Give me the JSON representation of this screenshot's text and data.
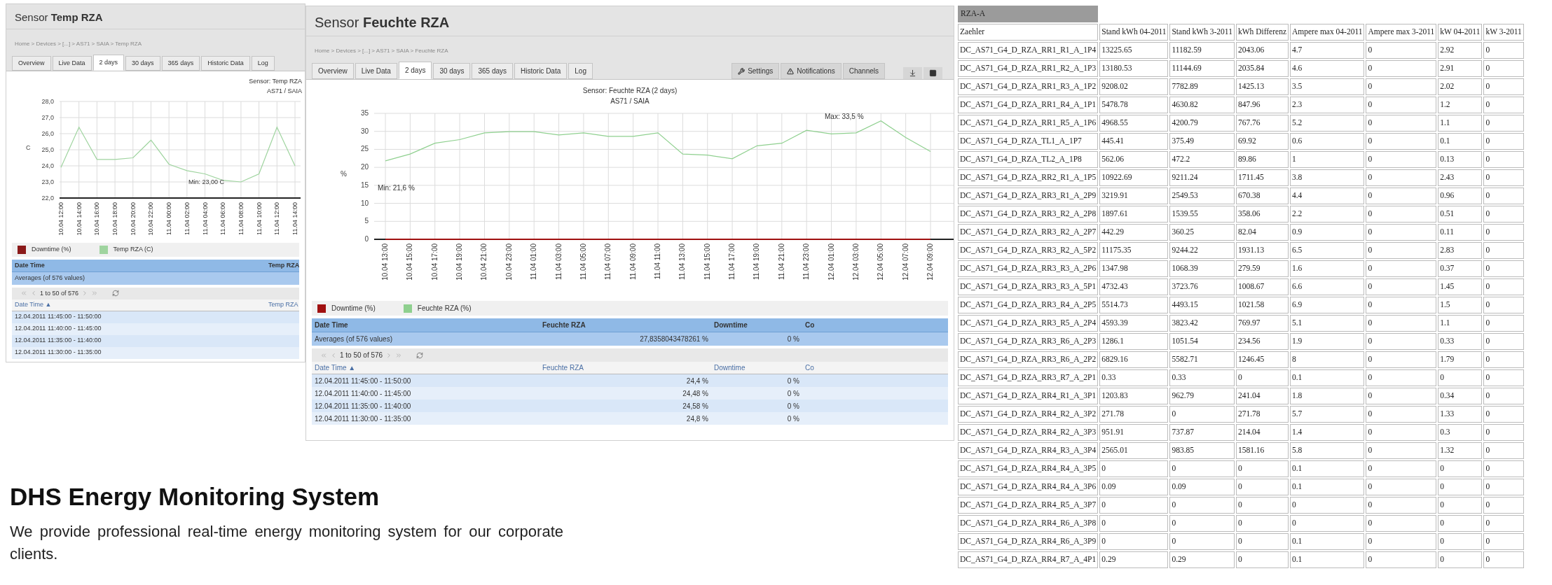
{
  "sensor_windows": [
    {
      "title": "Sensor **Temp RZA**",
      "breadcrumb": "Home > Devices > [...] > AS71 > SAIA > Temp RZA",
      "tabs": [
        {
          "label": "Overview",
          "selected": false
        },
        {
          "label": "Live Data",
          "selected": false
        },
        {
          "label": "2 days",
          "selected": true
        },
        {
          "label": "30 days",
          "selected": false
        },
        {
          "label": "365 days",
          "selected": false
        },
        {
          "label": "Historic Data",
          "selected": false
        },
        {
          "label": "Log",
          "selected": false
        }
      ],
      "chart_subtitle": "AS71 / SAIA",
      "chart_data": {
        "type": "line",
        "title": "Sensor: Temp RZA",
        "ylabel": "C",
        "categories": [
          "10.04 12:00",
          "10.04 14:00",
          "10.04 16:00",
          "10.04 18:00",
          "10.04 20:00",
          "10.04 22:00",
          "11.04 00:00",
          "11.04 02:00",
          "11.04 04:00",
          "11.04 06:00",
          "11.04 08:00",
          "11.04 10:00",
          "11.04 12:00",
          "11.04 14:00"
        ],
        "grid": true,
        "series": [
          {
            "name": "Downtime (%)",
            "color": "#8b1a1a",
            "values": [
              null,
              null,
              null,
              null,
              null,
              null,
              null,
              null,
              null,
              null,
              null,
              null,
              null,
              null
            ]
          },
          {
            "name": "Temp RZA (C)",
            "color": "#9fd49f",
            "values": [
              23.9,
              26.4,
              24.4,
              24.4,
              24.5,
              25.6,
              24.1,
              23.7,
              23.5,
              23.1,
              23.0,
              23.5,
              26.4,
              24.0
            ]
          }
        ],
        "ylim": [
          22,
          28
        ],
        "yticks": [
          {
            "value": 22,
            "label": "22,0"
          },
          {
            "value": 23,
            "label": "23,0"
          },
          {
            "value": 24,
            "label": "24,0"
          },
          {
            "value": 25,
            "label": "25,0"
          },
          {
            "value": 26,
            "label": "26,0"
          },
          {
            "value": 27,
            "label": "27,0"
          },
          {
            "value": 28,
            "label": "28,0"
          }
        ],
        "annotations": [
          "Min: 23,00 C"
        ]
      },
      "summary_columns": [
        "Date Time",
        "Temp RZA"
      ],
      "averages": [
        "Averages (of 576 values)"
      ],
      "pager": "1 to 50 of 576",
      "list_columns": [
        "Date Time ▲",
        "Temp RZA"
      ],
      "rows": [
        [
          "12.04.2011 11:45:00 - 11:50:00"
        ],
        [
          "12.04.2011 11:40:00 - 11:45:00"
        ],
        [
          "12.04.2011 11:35:00 - 11:40:00"
        ],
        [
          "12.04.2011 11:30:00 - 11:35:00"
        ]
      ]
    },
    {
      "title": "Sensor **Feuchte RZA**",
      "breadcrumb": "Home > Devices > [...] > AS71 > SAIA > Feuchte RZA",
      "tabs": [
        {
          "label": "Overview",
          "selected": false
        },
        {
          "label": "Live Data",
          "selected": false
        },
        {
          "label": "2 days",
          "selected": true
        },
        {
          "label": "30 days",
          "selected": false
        },
        {
          "label": "365 days",
          "selected": false
        },
        {
          "label": "Historic Data",
          "selected": false
        },
        {
          "label": "Log",
          "selected": false
        }
      ],
      "toolbar": [
        "Settings",
        "Notifications",
        "Channels"
      ],
      "chart_subtitle": "AS71 / SAIA",
      "chart_data": {
        "type": "line",
        "title": "Sensor: Feuchte RZA (2 days)",
        "ylabel": "%",
        "categories": [
          "10.04 13:00",
          "10.04 15:00",
          "10.04 17:00",
          "10.04 19:00",
          "10.04 21:00",
          "10.04 23:00",
          "11.04 01:00",
          "11.04 03:00",
          "11.04 05:00",
          "11.04 07:00",
          "11.04 09:00",
          "11.04 11:00",
          "11.04 13:00",
          "11.04 15:00",
          "11.04 17:00",
          "11.04 19:00",
          "11.04 21:00",
          "11.04 23:00",
          "12.04 01:00",
          "12.04 03:00",
          "12.04 05:00",
          "12.04 07:00",
          "12.04 09:00"
        ],
        "grid": true,
        "series": [
          {
            "name": "Downtime (%)",
            "color": "#a01010",
            "values": [
              0,
              0,
              0,
              0,
              0,
              0,
              0,
              0,
              0,
              0,
              0,
              0,
              0,
              0,
              0,
              0,
              0,
              0,
              0,
              0,
              0,
              0,
              0
            ]
          },
          {
            "name": "Feuchte RZA (%)",
            "color": "#8fd08f",
            "values": [
              21.8,
              23.7,
              26.7,
              27.7,
              29.6,
              29.9,
              29.9,
              29.0,
              29.6,
              28.6,
              28.6,
              29.6,
              23.7,
              23.4,
              22.4,
              26.0,
              26.7,
              30.3,
              29.3,
              29.6,
              32.9,
              28.3,
              24.4
            ]
          }
        ],
        "ylim": [
          0,
          35
        ],
        "yticks": [
          0,
          5,
          10,
          15,
          20,
          25,
          30,
          35
        ],
        "annotations": [
          "Min: 21,6 %",
          "Max: 33,5 %"
        ]
      },
      "summary_columns": [
        "Date Time",
        "Feuchte RZA",
        "Downtime",
        "Co"
      ],
      "averages": [
        "Averages (of 576 values)",
        "27,8358043478261 %",
        "0 %"
      ],
      "pager": "1 to 50 of 576",
      "list_columns": [
        "Date Time ▲",
        "Feuchte RZA",
        "Downtime",
        "Co"
      ],
      "rows": [
        [
          "12.04.2011 11:45:00 - 11:50:00",
          "24,4 %",
          "0 %"
        ],
        [
          "12.04.2011 11:40:00 - 11:45:00",
          "24,48 %",
          "0 %"
        ],
        [
          "12.04.2011 11:35:00 - 11:40:00",
          "24,58 %",
          "0 %"
        ],
        [
          "12.04.2011 11:30:00 - 11:35:00",
          "24,8 %",
          "0 %"
        ]
      ]
    }
  ],
  "intro": {
    "heading": "DHS Energy Monitoring System",
    "text": "We provide professional real-time energy monitoring system for our corporate clients."
  },
  "meter_table": {
    "title": "RZA-A",
    "columns": [
      "Zaehler",
      "Stand kWh 04-2011",
      "Stand kWh 3-2011",
      "kWh Differenz",
      "Ampere max 04-2011",
      "Ampere max 3-2011",
      "kW 04-2011",
      "kW 3-2011"
    ],
    "rows": [
      [
        "DC_AS71_G4_D_RZA_RR1_R1_A_1P4",
        "13225.65",
        "11182.59",
        "2043.06",
        "4.7",
        "0",
        "2.92",
        "0"
      ],
      [
        "DC_AS71_G4_D_RZA_RR1_R2_A_1P3",
        "13180.53",
        "11144.69",
        "2035.84",
        "4.6",
        "0",
        "2.91",
        "0"
      ],
      [
        "DC_AS71_G4_D_RZA_RR1_R3_A_1P2",
        "9208.02",
        "7782.89",
        "1425.13",
        "3.5",
        "0",
        "2.02",
        "0"
      ],
      [
        "DC_AS71_G4_D_RZA_RR1_R4_A_1P1",
        "5478.78",
        "4630.82",
        "847.96",
        "2.3",
        "0",
        "1.2",
        "0"
      ],
      [
        "DC_AS71_G4_D_RZA_RR1_R5_A_1P6",
        "4968.55",
        "4200.79",
        "767.76",
        "5.2",
        "0",
        "1.1",
        "0"
      ],
      [
        "DC_AS71_G4_D_RZA_TL1_A_1P7",
        "445.41",
        "375.49",
        "69.92",
        "0.6",
        "0",
        "0.1",
        "0"
      ],
      [
        "DC_AS71_G4_D_RZA_TL2_A_1P8",
        "562.06",
        "472.2",
        "89.86",
        "1",
        "0",
        "0.13",
        "0"
      ],
      [
        "DC_AS71_G4_D_RZA_RR2_R1_A_1P5",
        "10922.69",
        "9211.24",
        "1711.45",
        "3.8",
        "0",
        "2.43",
        "0"
      ],
      [
        "DC_AS71_G4_D_RZA_RR3_R1_A_2P9",
        "3219.91",
        "2549.53",
        "670.38",
        "4.4",
        "0",
        "0.96",
        "0"
      ],
      [
        "DC_AS71_G4_D_RZA_RR3_R2_A_2P8",
        "1897.61",
        "1539.55",
        "358.06",
        "2.2",
        "0",
        "0.51",
        "0"
      ],
      [
        "DC_AS71_G4_D_RZA_RR3_R2_A_2P7",
        "442.29",
        "360.25",
        "82.04",
        "0.9",
        "0",
        "0.11",
        "0"
      ],
      [
        "DC_AS71_G4_D_RZA_RR3_R2_A_5P2",
        "11175.35",
        "9244.22",
        "1931.13",
        "6.5",
        "0",
        "2.83",
        "0"
      ],
      [
        "DC_AS71_G4_D_RZA_RR3_R3_A_2P6",
        "1347.98",
        "1068.39",
        "279.59",
        "1.6",
        "0",
        "0.37",
        "0"
      ],
      [
        "DC_AS71_G4_D_RZA_RR3_R3_A_5P1",
        "4732.43",
        "3723.76",
        "1008.67",
        "6.6",
        "0",
        "1.45",
        "0"
      ],
      [
        "DC_AS71_G4_D_RZA_RR3_R4_A_2P5",
        "5514.73",
        "4493.15",
        "1021.58",
        "6.9",
        "0",
        "1.5",
        "0"
      ],
      [
        "DC_AS71_G4_D_RZA_RR3_R5_A_2P4",
        "4593.39",
        "3823.42",
        "769.97",
        "5.1",
        "0",
        "1.1",
        "0"
      ],
      [
        "DC_AS71_G4_D_RZA_RR3_R6_A_2P3",
        "1286.1",
        "1051.54",
        "234.56",
        "1.9",
        "0",
        "0.33",
        "0"
      ],
      [
        "DC_AS71_G4_D_RZA_RR3_R6_A_2P2",
        "6829.16",
        "5582.71",
        "1246.45",
        "8",
        "0",
        "1.79",
        "0"
      ],
      [
        "DC_AS71_G4_D_RZA_RR3_R7_A_2P1",
        "0.33",
        "0.33",
        "0",
        "0.1",
        "0",
        "0",
        "0"
      ],
      [
        "DC_AS71_G4_D_RZA_RR4_R1_A_3P1",
        "1203.83",
        "962.79",
        "241.04",
        "1.8",
        "0",
        "0.34",
        "0"
      ],
      [
        "DC_AS71_G4_D_RZA_RR4_R2_A_3P2",
        "271.78",
        "0",
        "271.78",
        "5.7",
        "0",
        "1.33",
        "0"
      ],
      [
        "DC_AS71_G4_D_RZA_RR4_R2_A_3P3",
        "951.91",
        "737.87",
        "214.04",
        "1.4",
        "0",
        "0.3",
        "0"
      ],
      [
        "DC_AS71_G4_D_RZA_RR4_R3_A_3P4",
        "2565.01",
        "983.85",
        "1581.16",
        "5.8",
        "0",
        "1.32",
        "0"
      ],
      [
        "DC_AS71_G4_D_RZA_RR4_R4_A_3P5",
        "0",
        "0",
        "0",
        "0.1",
        "0",
        "0",
        "0"
      ],
      [
        "DC_AS71_G4_D_RZA_RR4_R4_A_3P6",
        "0.09",
        "0.09",
        "0",
        "0.1",
        "0",
        "0",
        "0"
      ],
      [
        "DC_AS71_G4_D_RZA_RR4_R5_A_3P7",
        "0",
        "0",
        "0",
        "0",
        "0",
        "0",
        "0"
      ],
      [
        "DC_AS71_G4_D_RZA_RR4_R6_A_3P8",
        "0",
        "0",
        "0",
        "0",
        "0",
        "0",
        "0"
      ],
      [
        "DC_AS71_G4_D_RZA_RR4_R6_A_3P9",
        "0",
        "0",
        "0",
        "0.1",
        "0",
        "0",
        "0"
      ],
      [
        "DC_AS71_G4_D_RZA_RR4_R7_A_4P1",
        "0.29",
        "0.29",
        "0",
        "0.1",
        "0",
        "0",
        "0"
      ]
    ]
  }
}
